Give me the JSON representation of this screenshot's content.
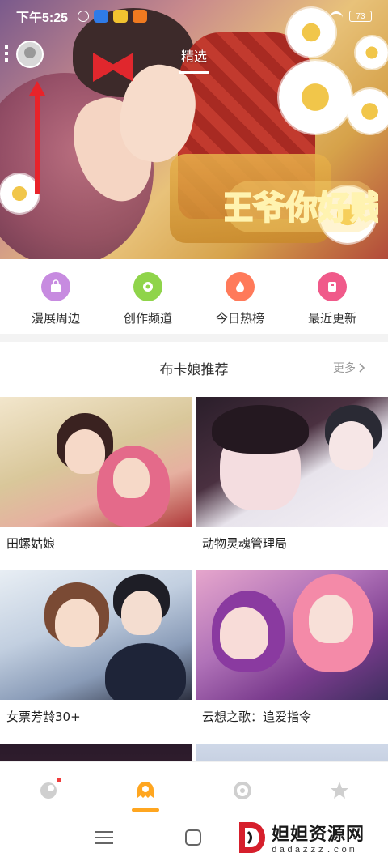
{
  "status_bar": {
    "time": "下午5:25",
    "battery": "73"
  },
  "header": {
    "active_tab": "精选"
  },
  "banner": {
    "logo_text": "王爷你好贱"
  },
  "categories": [
    {
      "label": "漫展周边",
      "icon": "bag-icon",
      "color": "#c78be0"
    },
    {
      "label": "创作频道",
      "icon": "create-icon",
      "color": "#8fd44a"
    },
    {
      "label": "今日热榜",
      "icon": "fire-icon",
      "color": "#ff7a5a"
    },
    {
      "label": "最近更新",
      "icon": "update-icon",
      "color": "#f05a8a"
    }
  ],
  "section": {
    "title": "布卡娘推荐",
    "more_label": "更多"
  },
  "comics": [
    {
      "title": "田螺姑娘"
    },
    {
      "title": "动物灵魂管理局"
    },
    {
      "title": "女票芳龄30+"
    },
    {
      "title": "云想之歌：追爱指令"
    }
  ],
  "tabbar": {
    "items": [
      {
        "name": "discover-icon",
        "badge": true
      },
      {
        "name": "home-mascot-icon",
        "active": true
      },
      {
        "name": "refresh-icon"
      },
      {
        "name": "star-icon"
      }
    ],
    "accent": "#ffa620"
  },
  "watermark": {
    "cn": "妲妲资源网",
    "en": "dadazzz.com"
  }
}
